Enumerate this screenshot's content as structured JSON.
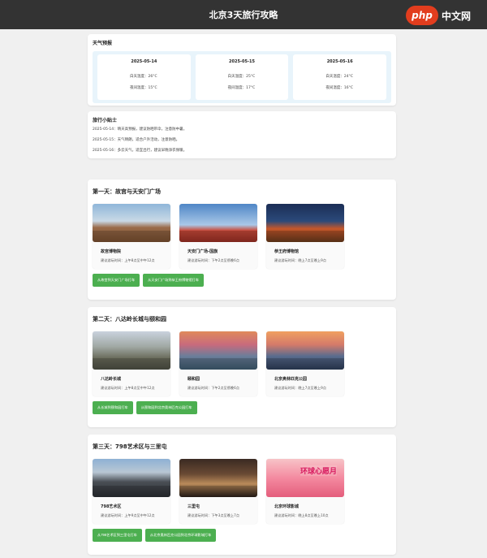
{
  "header": {
    "title": "北京3天旅行攻略",
    "watermark_logo": "php",
    "watermark_text": "中文网"
  },
  "weather": {
    "title": "天气预报",
    "days": [
      {
        "date": "2025-05-14",
        "high": "白天温度：26°C",
        "low": "夜间温度：15°C"
      },
      {
        "date": "2025-05-15",
        "high": "白天温度：25°C",
        "low": "夜间温度：17°C"
      },
      {
        "date": "2025-05-16",
        "high": "白天温度：24°C",
        "low": "夜间温度：16°C"
      }
    ]
  },
  "tips": {
    "title": "旅行小贴士",
    "lines": [
      "2025-05-14：晴天高预报，建议防晒带伞，注意防中暑。",
      "2025-05-15：天气晴朗，适合户外活动，注意防晒。",
      "2025-05-16：多云天气，适宜出行，建议早晚添衣保暖。"
    ]
  },
  "days": [
    {
      "title": "第一天：故宫与天安门广场",
      "places": [
        {
          "name": "故宫博物院",
          "desc": "建议游玩时间：上午8点至中午12点",
          "img": "gugong"
        },
        {
          "name": "天安门广场-国旗",
          "desc": "建议游玩时间：下午2点至傍晚6点",
          "img": "tiananmen"
        },
        {
          "name": "恭王府博物馆",
          "desc": "建议游玩时间：晚上7点至晚上9点",
          "img": "gongwangfu"
        }
      ],
      "buttons": [
        "从故宫到天安门广场打车",
        "从天安门广场到恭王府博物馆打车"
      ]
    },
    {
      "title": "第二天：八达岭长城与颐和园",
      "places": [
        {
          "name": "八达岭长城",
          "desc": "建议游玩时间：上午8点至中午12点",
          "img": "badaling"
        },
        {
          "name": "颐和园",
          "desc": "建议游玩时间：下午2点至傍晚6点",
          "img": "yiheyuan"
        },
        {
          "name": "北京奥林匹克公园",
          "desc": "建议游玩时间：晚上7点至晚上9点",
          "img": "olympic"
        }
      ],
      "buttons": [
        "从长城到颐和园打车",
        "从颐和园到北京奥林匹克公园打车"
      ]
    },
    {
      "title": "第三天：798艺术区与三里屯",
      "places": [
        {
          "name": "798艺术区",
          "desc": "建议游玩时间：上午9点至中午12点",
          "img": "798"
        },
        {
          "name": "三里屯",
          "desc": "建议游玩时间：下午3点至晚上7点",
          "img": "sanlitun",
          "img_text": ""
        },
        {
          "name": "北京环球影城",
          "desc": "建议游玩时间：晚上8点至晚上10点",
          "img": "universal",
          "img_text": "环球心愿月"
        }
      ],
      "buttons": [
        "从798艺术区到三里屯打车",
        "从北京奥林匹克公园到北京环球影城打车"
      ]
    }
  ]
}
